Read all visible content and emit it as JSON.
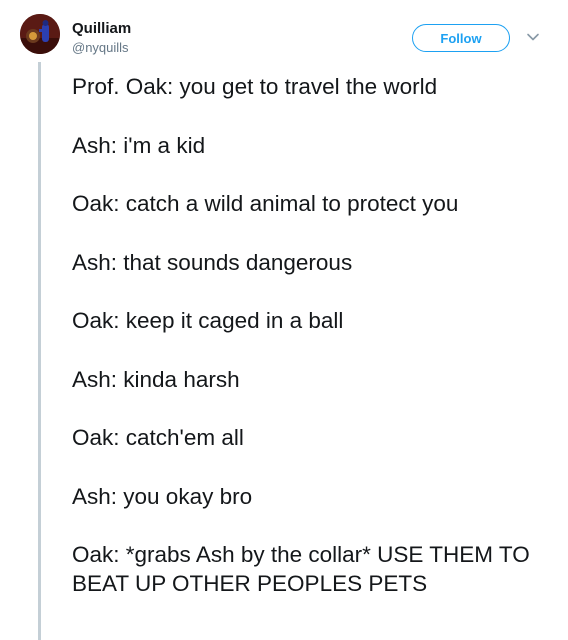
{
  "author": {
    "name": "Quilliam",
    "handle": "@nyquills",
    "avatar_icon": "avatar-icon"
  },
  "actions": {
    "follow_label": "Follow",
    "more_icon": "chevron-down-icon"
  },
  "colors": {
    "accent": "#1da1f2",
    "text": "#14171a",
    "muted": "#657786",
    "thread_line": "#c4cfd6"
  },
  "tweet_lines": [
    "Prof. Oak: you get to travel the world",
    "Ash: i'm a kid",
    "Oak: catch a wild animal to protect you",
    "Ash: that sounds dangerous",
    "Oak: keep it caged in a ball",
    "Ash: kinda harsh",
    "Oak: catch'em all",
    "Ash: you okay bro",
    "Oak: *grabs Ash by the collar* USE THEM TO BEAT UP OTHER PEOPLES PETS"
  ]
}
